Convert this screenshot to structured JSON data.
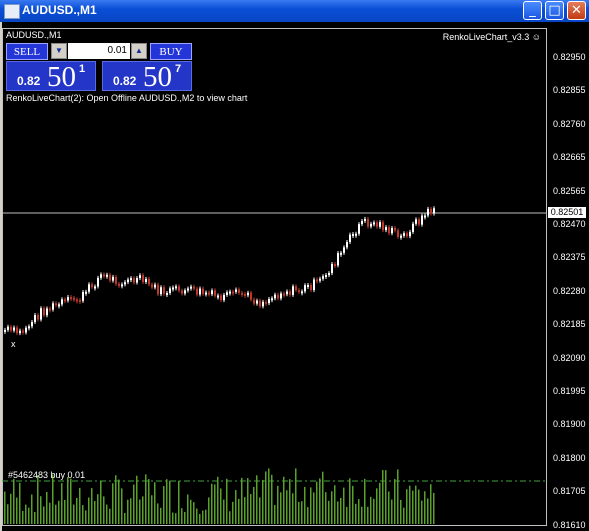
{
  "window": {
    "title": "AUDUSD.,M1",
    "minimize_glyph": "_",
    "maximize_glyph": "□",
    "close_glyph": "✕"
  },
  "chart": {
    "symbol_label": "AUDUSD.,M1",
    "indicator_name": "RenkoLiveChart_v3.3 ☺",
    "renko_message": "RenkoLiveChart(2): Open Offline AUDUSD.,M2 to view chart",
    "order_label": "#5462483 buy 0.01",
    "start_marker": "x",
    "current_price_tag": "0.82501",
    "price_levels": [
      "0.82950",
      "0.82855",
      "0.82760",
      "0.82665",
      "0.82565",
      "0.82470",
      "0.82375",
      "0.82280",
      "0.82185",
      "0.82090",
      "0.81995",
      "0.81900",
      "0.81800",
      "0.81705",
      "0.81610"
    ],
    "colors": {
      "background": "#000000",
      "bull_candle": "#ffffff",
      "bear_candle": "#c0392b",
      "volume": "#5aa02c",
      "order_line": "#3fa33f",
      "price_line": "#c0c0c0"
    }
  },
  "trade_panel": {
    "sell_label": "SELL",
    "buy_label": "BUY",
    "lot_value": "0.01",
    "down_arrow": "▼",
    "up_arrow": "▲",
    "sell_quote": {
      "prefix": "0.82",
      "big": "50",
      "sup": "1"
    },
    "buy_quote": {
      "prefix": "0.82",
      "big": "50",
      "sup": "7"
    }
  }
}
